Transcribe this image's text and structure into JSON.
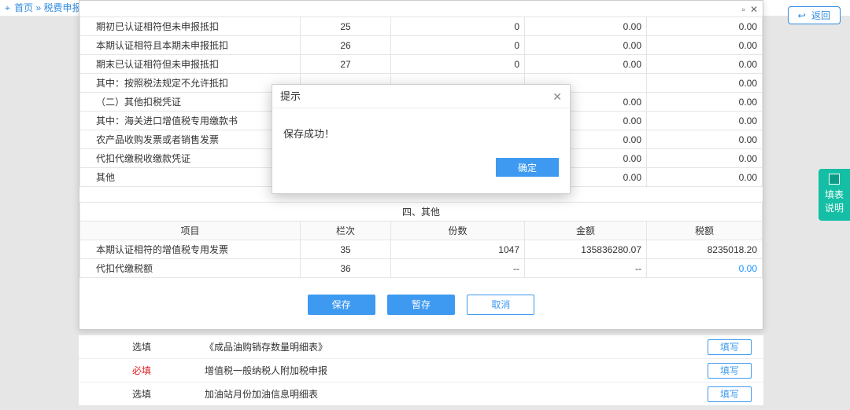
{
  "crumb": {
    "home": "首页",
    "sep": "»",
    "page": "税费申报及缴"
  },
  "return_btn": "返回",
  "side_tab": "填表说明",
  "window": {
    "min": "▫",
    "close": "✕"
  },
  "table": {
    "rows": [
      {
        "name": "期初已认证相符但未申报抵扣",
        "col": "25",
        "copies": "0",
        "amount": "0.00",
        "tax": "0.00"
      },
      {
        "name": "本期认证相符且本期未申报抵扣",
        "col": "26",
        "copies": "0",
        "amount": "0.00",
        "tax": "0.00"
      },
      {
        "name": "期末已认证相符但未申报抵扣",
        "col": "27",
        "copies": "0",
        "amount": "0.00",
        "tax": "0.00"
      },
      {
        "name": "其中：按照税法规定不允许抵扣",
        "col": "",
        "copies": "",
        "amount": "",
        "tax": "0.00"
      },
      {
        "name": "（二）其他扣税凭证",
        "col": "",
        "copies": "",
        "amount": "0.00",
        "tax": "0.00"
      },
      {
        "name": "其中：海关进口增值税专用缴款书",
        "col": "",
        "copies": "",
        "amount": "0.00",
        "tax": "0.00"
      },
      {
        "name": "农产品收购发票或者销售发票",
        "col": "",
        "copies": "",
        "amount": "0.00",
        "tax": "0.00"
      },
      {
        "name": "代扣代缴税收缴款凭证",
        "col": "",
        "copies": "",
        "amount": "0.00",
        "tax": "0.00"
      },
      {
        "name": "其他",
        "col": "",
        "copies": "",
        "amount": "0.00",
        "tax": "0.00"
      }
    ],
    "section_header": "四、其他",
    "columns": {
      "c1": "项目",
      "c2": "栏次",
      "c3": "份数",
      "c4": "金额",
      "c5": "税额"
    },
    "rows2": [
      {
        "name": "本期认证相符的增值税专用发票",
        "col": "35",
        "copies": "1047",
        "amount": "135836280.07",
        "tax": "8235018.20"
      },
      {
        "name": "代扣代缴税额",
        "col": "36",
        "copies": "--",
        "amount": "--",
        "tax": "0.00",
        "hl": true
      }
    ]
  },
  "actions": {
    "save": "保存",
    "temp": "暂存",
    "cancel": "取消"
  },
  "alert": {
    "title": "提示",
    "msg": "保存成功！",
    "ok": "确定"
  },
  "bg_list": {
    "opt": "选填",
    "req": "必填",
    "fill": "填写",
    "items": [
      {
        "tag": "opt",
        "name": "《成品油购销存数量明细表》"
      },
      {
        "tag": "req",
        "name": "增值税一般纳税人附加税申报"
      },
      {
        "tag": "opt",
        "name": "加油站月份加油信息明细表"
      }
    ]
  }
}
